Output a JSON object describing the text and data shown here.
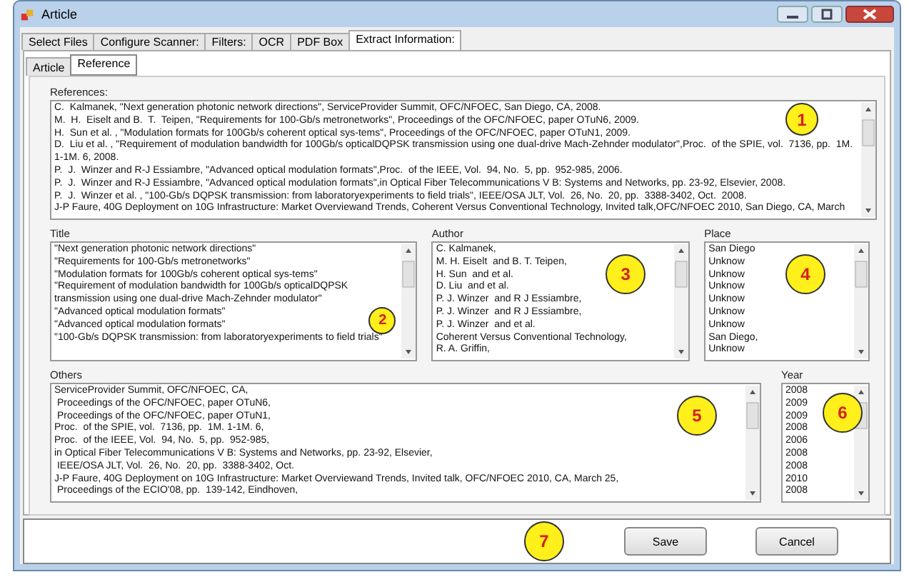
{
  "window": {
    "title": "Article"
  },
  "tabs": [
    {
      "label": "Select Files",
      "selected": false
    },
    {
      "label": "Configure Scanner:",
      "selected": false
    },
    {
      "label": "Filters:",
      "selected": false
    },
    {
      "label": "OCR",
      "selected": false
    },
    {
      "label": "PDF Box",
      "selected": false
    },
    {
      "label": "Extract Information:",
      "selected": true
    }
  ],
  "subtabs": [
    {
      "label": "Article",
      "selected": false
    },
    {
      "label": "Reference",
      "selected": true
    }
  ],
  "references": {
    "label": "References:",
    "marker": "1",
    "lines": [
      "C.  Kalmanek, \"Next generation photonic network directions\", ServiceProvider Summit, OFC/NFOEC, San Diego, CA, 2008.",
      "M.  H.  Eiselt and B.  T.  Teipen, \"Requirements for 100-Gb/s metronetworks\", Proceedings of the OFC/NFOEC, paper OTuN6, 2009.",
      "H.  Sun et al. , \"Modulation formats for 100Gb/s coherent optical sys-tems\", Proceedings of the OFC/NFOEC, paper OTuN1, 2009.",
      "D.  Liu et al. , \"Requirement of modulation bandwidth for 100Gb/s opticalDQPSK transmission using one dual-drive Mach-Zehnder modulator\",Proc.  of the SPIE, vol.  7136, pp.  1M. 1-1M. 6, 2008.",
      "P.  J.  Winzer and R-J Essiambre, \"Advanced optical modulation formats\",Proc.  of the IEEE, Vol.  94, No.  5, pp.  952-985, 2006.",
      "P.  J.  Winzer and R-J Essiambre, \"Advanced optical modulation formats\",in Optical Fiber Telecommunications V B: Systems and Networks, pp. 23-92, Elsevier, 2008.",
      "P.  J.  Winzer et al. , \"100-Gb/s DQPSK transmission: from laboratoryexperiments to field trials\", IEEE/OSA JLT, Vol.  26, No.  20, pp.  3388-3402, Oct.  2008.",
      "J-P Faure, 40G Deployment on 10G Infrastructure: Market Overviewand Trends, Coherent Versus Conventional Technology, Invited talk,OFC/NFOEC 2010, San Diego, CA, March"
    ]
  },
  "columns": [
    {
      "label": "Title",
      "marker": "2",
      "lines": [
        "\"Next generation photonic network directions\"",
        "\"Requirements for 100-Gb/s metronetworks\"",
        "\"Modulation formats for 100Gb/s coherent optical sys-tems\"",
        "\"Requirement of modulation bandwidth for 100Gb/s opticalDQPSK transmission using one dual-drive Mach-Zehnder modulator\"",
        "\"Advanced optical modulation formats\"",
        "\"Advanced optical modulation formats\"",
        "\"100-Gb/s DQPSK transmission: from laboratoryexperiments to field trials\""
      ]
    },
    {
      "label": "Author",
      "marker": "3",
      "lines": [
        "C. Kalmanek,",
        "M. H. Eiselt  and B. T. Teipen,",
        "H. Sun  and et al.",
        "D. Liu  and et al.",
        "P. J. Winzer  and R J Essiambre,",
        "P. J. Winzer  and R J Essiambre,",
        "P. J. Winzer  and et al.",
        "Coherent Versus Conventional Technology,",
        "R. A. Griffin,"
      ]
    },
    {
      "label": "Place",
      "marker": "4",
      "lines": [
        "San Diego",
        "Unknow",
        "Unknow",
        "Unknow",
        "Unknow",
        "Unknow",
        "Unknow",
        "San Diego,",
        "Unknow"
      ]
    }
  ],
  "others": {
    "label": "Others",
    "marker": "5",
    "lines": [
      "ServiceProvider Summit, OFC/NFOEC, CA,",
      " Proceedings of the OFC/NFOEC, paper OTuN6,",
      " Proceedings of the OFC/NFOEC, paper OTuN1,",
      "Proc.  of the SPIE, vol.  7136, pp.  1M. 1-1M. 6,",
      "Proc.  of the IEEE, Vol.  94, No.  5, pp.  952-985,",
      "in Optical Fiber Telecommunications V B: Systems and Networks, pp. 23-92, Elsevier,",
      " IEEE/OSA JLT, Vol.  26, No.  20, pp.  3388-3402, Oct.",
      "J-P Faure, 40G Deployment on 10G Infrastructure: Market Overviewand Trends, Invited talk, OFC/NFOEC 2010, CA, March 25,",
      " Proceedings of the ECIO'08, pp.  139-142, Eindhoven,"
    ]
  },
  "year": {
    "label": "Year",
    "marker": "6",
    "lines": [
      "2008",
      "2009",
      "2009",
      "2008",
      "2006",
      "2008",
      "2008",
      "2010",
      "2008"
    ]
  },
  "footer": {
    "marker": "7",
    "buttons": [
      "Save",
      "Cancel"
    ]
  }
}
